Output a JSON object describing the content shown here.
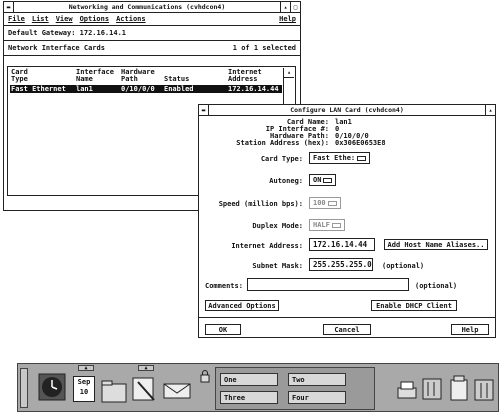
{
  "net_window": {
    "title": "Networking and Communications (cvhdcon4)",
    "menu": [
      "File",
      "List",
      "View",
      "Options",
      "Actions"
    ],
    "help": "Help",
    "default_gateway": "Default Gateway: 172.16.14.1",
    "section_title": "Network Interface Cards",
    "selected_count": "1 of 1 selected",
    "columns": {
      "card_type": [
        "Card",
        "Type"
      ],
      "interface_name": [
        "Interface",
        "Name"
      ],
      "hardware_path": [
        "Hardware",
        "Path"
      ],
      "status": [
        "Status"
      ],
      "internet_address": [
        "Internet",
        "Address"
      ]
    },
    "row": {
      "card_type": "Fast Ethernet",
      "interface_name": "lan1",
      "hardware_path": "0/10/0/0",
      "status": "Enabled",
      "internet_address": "172.16.14.44"
    }
  },
  "dialog": {
    "title": "Configure LAN Card (cvhdcon4)",
    "info_labels": [
      "Card Name:",
      "IP Interface #:",
      "Hardware Path:",
      "Station Address (hex):"
    ],
    "info_values": [
      "lan1",
      "0",
      "0/10/0/0",
      "0x306E0653E8"
    ],
    "card_type_label": "Card Type:",
    "card_type_value": "Fast Ethe:",
    "autoneg_label": "Autoneg:",
    "autoneg_value": "ON",
    "speed_label": "Speed (million bps):",
    "speed_value": "100",
    "duplex_label": "Duplex Mode:",
    "duplex_value": "HALF",
    "internet_address_label": "Internet Address:",
    "internet_address_value": "172.16.14.44",
    "add_aliases_button": "Add Host Name Aliases..",
    "subnet_mask_label": "Subnet Mask:",
    "subnet_mask_value": "255.255.255.0",
    "optional_1": "(optional)",
    "comments_label": "Comments:",
    "comments_value": "",
    "optional_2": "(optional)",
    "advanced_options_button": "Advanced Options",
    "enable_dhcp_button": "Enable DHCP Client",
    "ok_button": "OK",
    "cancel_button": "Cancel",
    "help_button": "Help"
  },
  "taskbar": {
    "calendar_month": "Sep",
    "calendar_day": "10",
    "workspaces": [
      "One",
      "Two",
      "Three",
      "Four"
    ]
  },
  "colors": {
    "background": "#ffffff",
    "selection": "#111111",
    "taskbar": "#a9a9a9"
  }
}
